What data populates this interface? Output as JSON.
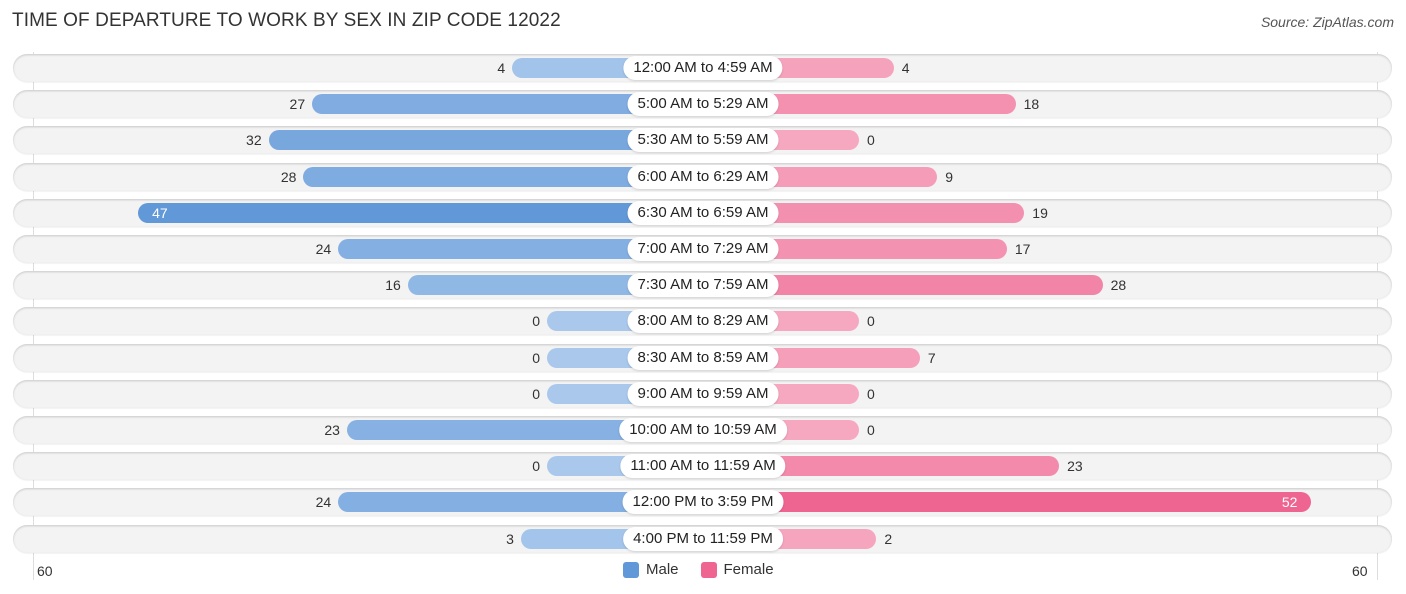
{
  "header": {
    "title": "TIME OF DEPARTURE TO WORK BY SEX IN ZIP CODE 12022",
    "source": "Source: ZipAtlas.com"
  },
  "colors": {
    "male_strong": "#6198d8",
    "male_light": "#a9c8ec",
    "female_strong": "#ef6592",
    "female_light": "#f6a8c1"
  },
  "chart_data": {
    "type": "bar",
    "orientation": "horizontal-diverging",
    "title": "TIME OF DEPARTURE TO WORK BY SEX IN ZIP CODE 12022",
    "categories": [
      "12:00 AM to 4:59 AM",
      "5:00 AM to 5:29 AM",
      "5:30 AM to 5:59 AM",
      "6:00 AM to 6:29 AM",
      "6:30 AM to 6:59 AM",
      "7:00 AM to 7:29 AM",
      "7:30 AM to 7:59 AM",
      "8:00 AM to 8:29 AM",
      "8:30 AM to 8:59 AM",
      "9:00 AM to 9:59 AM",
      "10:00 AM to 10:59 AM",
      "11:00 AM to 11:59 AM",
      "12:00 PM to 3:59 PM",
      "4:00 PM to 11:59 PM"
    ],
    "series": [
      {
        "name": "Male",
        "values": [
          4,
          27,
          32,
          28,
          47,
          24,
          16,
          0,
          0,
          0,
          23,
          0,
          24,
          3
        ]
      },
      {
        "name": "Female",
        "values": [
          4,
          18,
          0,
          9,
          19,
          17,
          28,
          0,
          7,
          0,
          0,
          23,
          52,
          2
        ]
      }
    ],
    "axis": {
      "left_label": "60",
      "right_label": "60",
      "range": [
        -60,
        60
      ]
    },
    "legend": {
      "position": "bottom-center",
      "items": [
        "Male",
        "Female"
      ]
    },
    "grid": false
  }
}
